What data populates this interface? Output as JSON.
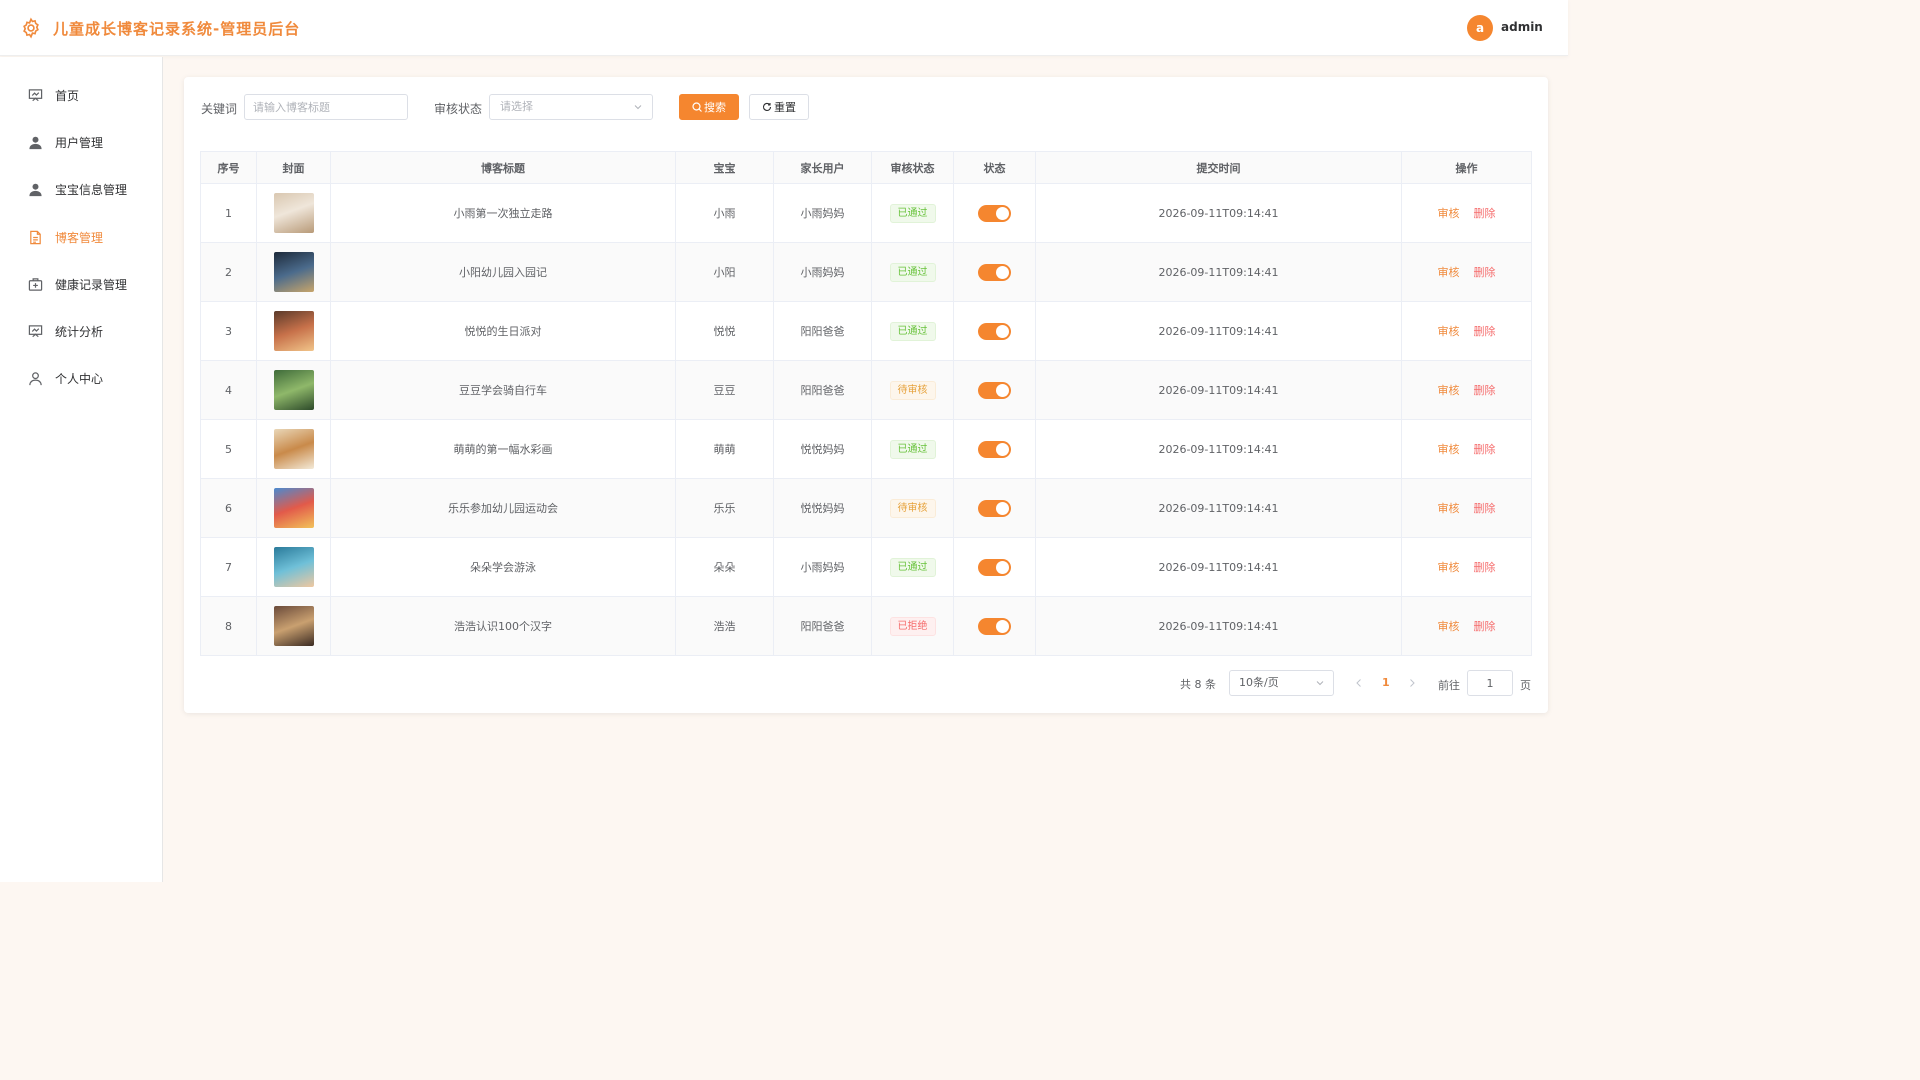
{
  "header": {
    "title": "儿童成长博客记录系统-管理员后台",
    "avatar_letter": "a",
    "username": "admin"
  },
  "sidebar": {
    "items": [
      {
        "label": "首页",
        "icon": "presentation-icon"
      },
      {
        "label": "用户管理",
        "icon": "user-icon"
      },
      {
        "label": "宝宝信息管理",
        "icon": "user-icon"
      },
      {
        "label": "博客管理",
        "icon": "document-icon",
        "active": true
      },
      {
        "label": "健康记录管理",
        "icon": "first-aid-icon"
      },
      {
        "label": "统计分析",
        "icon": "presentation-icon"
      },
      {
        "label": "个人中心",
        "icon": "user-outline-icon"
      }
    ]
  },
  "filters": {
    "keyword_label": "关键词",
    "keyword_placeholder": "请输入博客标题",
    "keyword_value": "",
    "status_label": "审核状态",
    "status_placeholder": "请选择",
    "search_button": "搜索",
    "reset_button": "重置"
  },
  "table": {
    "columns": [
      "序号",
      "封面",
      "博客标题",
      "宝宝",
      "家长用户",
      "审核状态",
      "状态",
      "提交时间",
      "操作"
    ],
    "action_audit": "审核",
    "action_delete": "删除",
    "rows": [
      {
        "index": "1",
        "title": "小雨第一次独立走路",
        "baby": "小雨",
        "parent": "小雨妈妈",
        "review": "已通过",
        "review_type": "approved",
        "enabled": true,
        "time": "2026-09-11T09:14:41",
        "cover": "toddler-walking-photo"
      },
      {
        "index": "2",
        "title": "小阳幼儿园入园记",
        "baby": "小阳",
        "parent": "小雨妈妈",
        "review": "已通过",
        "review_type": "approved",
        "enabled": true,
        "time": "2026-09-11T09:14:41",
        "cover": "kindergarten-photo"
      },
      {
        "index": "3",
        "title": "悦悦的生日派对",
        "baby": "悦悦",
        "parent": "阳阳爸爸",
        "review": "已通过",
        "review_type": "approved",
        "enabled": true,
        "time": "2026-09-11T09:14:41",
        "cover": "birthday-party-photo"
      },
      {
        "index": "4",
        "title": "豆豆学会骑自行车",
        "baby": "豆豆",
        "parent": "阳阳爸爸",
        "review": "待审核",
        "review_type": "pending",
        "enabled": true,
        "time": "2026-09-11T09:14:41",
        "cover": "bicycle-photo"
      },
      {
        "index": "5",
        "title": "萌萌的第一幅水彩画",
        "baby": "萌萌",
        "parent": "悦悦妈妈",
        "review": "已通过",
        "review_type": "approved",
        "enabled": true,
        "time": "2026-09-11T09:14:41",
        "cover": "watercolor-photo"
      },
      {
        "index": "6",
        "title": "乐乐参加幼儿园运动会",
        "baby": "乐乐",
        "parent": "悦悦妈妈",
        "review": "待审核",
        "review_type": "pending",
        "enabled": true,
        "time": "2026-09-11T09:14:41",
        "cover": "sports-day-photo"
      },
      {
        "index": "7",
        "title": "朵朵学会游泳",
        "baby": "朵朵",
        "parent": "小雨妈妈",
        "review": "已通过",
        "review_type": "approved",
        "enabled": true,
        "time": "2026-09-11T09:14:41",
        "cover": "swimming-photo"
      },
      {
        "index": "8",
        "title": "浩浩认识100个汉字",
        "baby": "浩浩",
        "parent": "阳阳爸爸",
        "review": "已拒绝",
        "review_type": "rejected",
        "enabled": true,
        "time": "2026-09-11T09:14:41",
        "cover": "reading-photo"
      }
    ]
  },
  "pagination": {
    "total_text": "共 8 条",
    "page_size": "10条/页",
    "current_page": "1",
    "goto_label": "前往",
    "goto_value": "1",
    "page_suffix": "页"
  },
  "colors": {
    "accent": "#f5862f",
    "approved_text": "#67c23a",
    "approved_bg": "#f0f9eb",
    "approved_border": "#e1f3d8",
    "pending_text": "#e6a23c",
    "pending_bg": "#fdf6ec",
    "pending_border": "#faecd8",
    "rejected_text": "#f56c6c",
    "rejected_bg": "#fef0f0",
    "rejected_border": "#fde2e2"
  }
}
